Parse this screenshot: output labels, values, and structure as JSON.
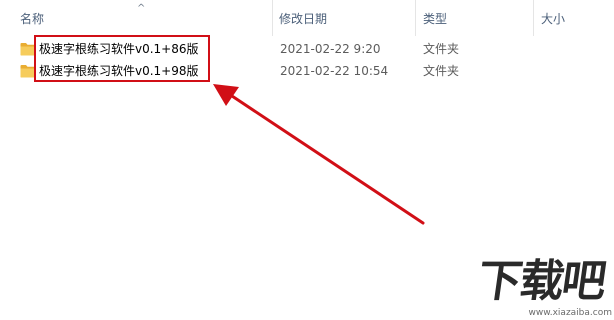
{
  "columns": {
    "name": "名称",
    "date": "修改日期",
    "type": "类型",
    "size": "大小",
    "sort_indicator": "^"
  },
  "rows": [
    {
      "name": "极速字根练习软件v0.1+86版",
      "date": "2021-02-22 9:20",
      "type": "文件夹",
      "icon": "folder-icon"
    },
    {
      "name": "极速字根练习软件v0.1+98版",
      "date": "2021-02-22 10:54",
      "type": "文件夹",
      "icon": "folder-icon"
    }
  ],
  "annotation": {
    "color": "#d10f16"
  },
  "watermark": {
    "main": "下载吧",
    "url": "www.xiazaiba.com"
  },
  "colors": {
    "folder": "#f2c14e",
    "header_text": "#4c607a"
  }
}
